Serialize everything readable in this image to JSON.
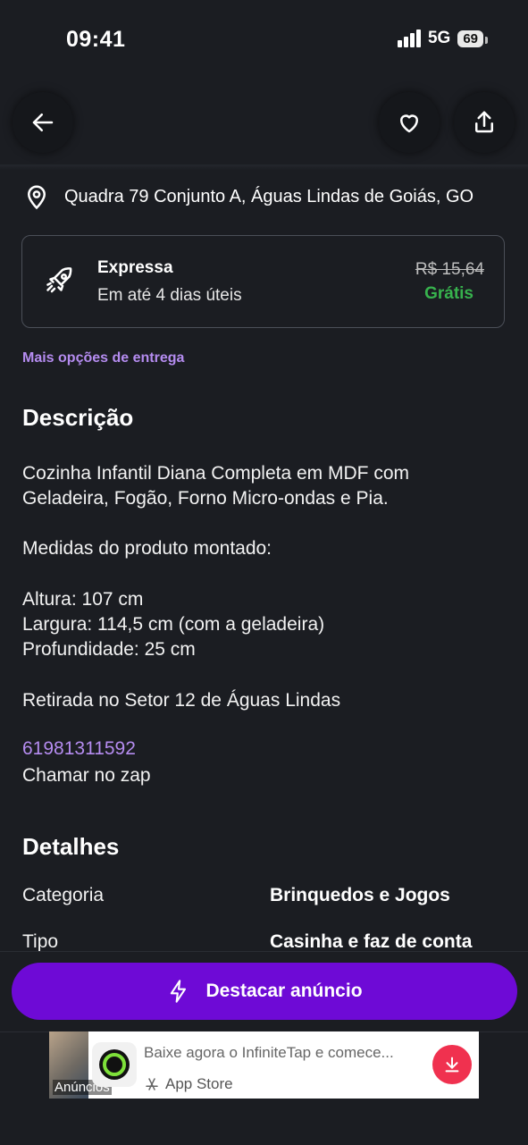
{
  "status_bar": {
    "time": "09:41",
    "network": "5G",
    "battery": "69"
  },
  "location": {
    "address": "Quadra 79 Conjunto A, Águas Lindas de Goiás, GO"
  },
  "delivery": {
    "title": "Expressa",
    "subtitle": "Em até 4 dias úteis",
    "old_price": "R$ 15,64",
    "price": "Grátis",
    "more_options": "Mais opções de entrega"
  },
  "description": {
    "heading": "Descrição",
    "line1": "Cozinha Infantil Diana Completa em MDF com",
    "line2": "Geladeira, Fogão, Forno Micro-ondas e Pia.",
    "line3": "Medidas do produto montado:",
    "line4": "Altura: 107 cm",
    "line5": "Largura: 114,5 cm (com a geladeira)",
    "line6": "Profundidade: 25 cm",
    "line7": "Retirada no Setor 12 de Águas Lindas",
    "phone": "61981311592",
    "line8": "Chamar no zap"
  },
  "details": {
    "heading": "Detalhes",
    "rows": [
      {
        "label": "Categoria",
        "value": "Brinquedos e Jogos"
      },
      {
        "label": "Tipo",
        "value": "Casinha e faz de conta"
      }
    ]
  },
  "cta": {
    "label": "Destacar anúncio"
  },
  "ad": {
    "label": "Anúncios",
    "title": "Baixe agora o InfiniteTap e comece...",
    "store": "App Store"
  },
  "colors": {
    "accent": "#6e0ad6",
    "link": "#b58cf0",
    "free": "#37b24d",
    "ad_download": "#f0314f"
  }
}
